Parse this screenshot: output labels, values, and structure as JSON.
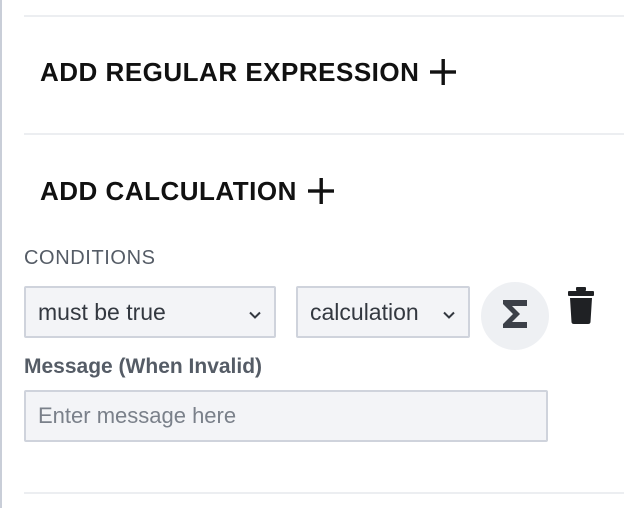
{
  "sections": {
    "regular_expression": {
      "title": "ADD REGULAR EXPRESSION",
      "icon": "plus-icon"
    },
    "calculation": {
      "title": "ADD CALCULATION",
      "icon": "plus-icon"
    }
  },
  "conditions": {
    "label": "CONDITIONS",
    "rule_select": {
      "value": "must be true"
    },
    "type_select": {
      "value": "calculation"
    },
    "sigma_button_icon": "sigma-icon",
    "delete_button_icon": "trash-icon"
  },
  "message": {
    "label": "Message (When Invalid)",
    "placeholder": "Enter message here",
    "value": ""
  },
  "colors": {
    "text": "#111111",
    "label": "#555c66",
    "field_bg": "#f3f4f7",
    "field_border": "#cfd3dc",
    "divider": "#eceef1",
    "sigma_bg": "#eef0f3"
  }
}
